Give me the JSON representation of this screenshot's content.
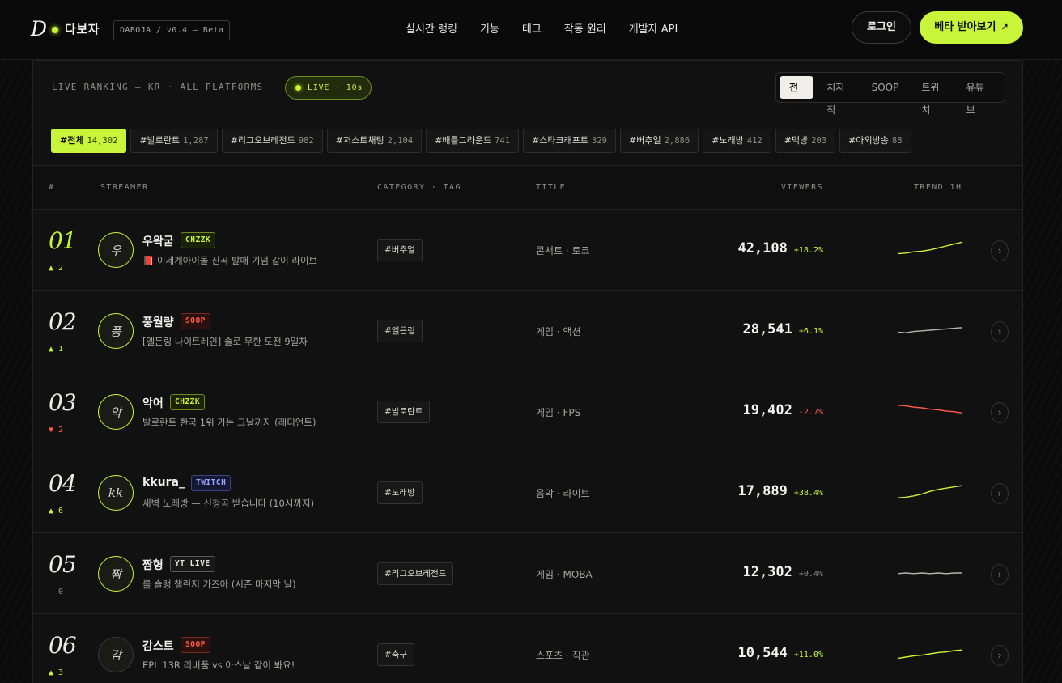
{
  "brand": {
    "logo_letter": "D",
    "name": "다보자",
    "version": "DABOJA / v0.4 — Beta",
    "accent": "#c8f53a"
  },
  "nav": [
    {
      "label": "실시간 랭킹"
    },
    {
      "label": "기능"
    },
    {
      "label": "태그"
    },
    {
      "label": "작동 원리"
    },
    {
      "label": "개발자 API"
    }
  ],
  "auth": {
    "login_label": "로그인",
    "beta_label": "베타 받아보기",
    "beta_arrow": "↗"
  },
  "panel": {
    "title": "LIVE RANKING — KR · ALL PLATFORMS",
    "live_badge": "LIVE · 10s",
    "platform_filters": [
      {
        "label": "전체",
        "active": true
      },
      {
        "label": "치지직",
        "active": false
      },
      {
        "label": "SOOP",
        "active": false
      },
      {
        "label": "트위치",
        "active": false
      },
      {
        "label": "유튜브",
        "active": false
      }
    ]
  },
  "tags": [
    {
      "label": "#전체",
      "count": "14,302",
      "active": true
    },
    {
      "label": "#발로란트",
      "count": "1,287",
      "active": false
    },
    {
      "label": "#리그오브레전드",
      "count": "982",
      "active": false
    },
    {
      "label": "#저스트채팅",
      "count": "2,104",
      "active": false
    },
    {
      "label": "#배틀그라운드",
      "count": "741",
      "active": false
    },
    {
      "label": "#스타크래프트",
      "count": "329",
      "active": false
    },
    {
      "label": "#버추얼",
      "count": "2,886",
      "active": false
    },
    {
      "label": "#노래방",
      "count": "412",
      "active": false
    },
    {
      "label": "#먹방",
      "count": "203",
      "active": false
    },
    {
      "label": "#아외방송",
      "count": "88",
      "active": false
    }
  ],
  "columns": {
    "rank": "#",
    "streamer": "STREAMER",
    "category": "CATEGORY · TAG",
    "title": "TITLE",
    "viewers": "VIEWERS",
    "trend": "TREND 1H"
  },
  "rows": [
    {
      "rank": "01",
      "delta": "▲ 2",
      "delta_dir": "up",
      "avatar": "우",
      "name": "우왁굳",
      "platform": "CHZZK",
      "platform_key": "chzzk",
      "stream_title": "📕 이세계아이돌 신곡 발매 기념 같이 라이브",
      "tag": "#버추얼",
      "genre": "콘서트 · 토크",
      "viewers": "42,108",
      "change": "+18.2%",
      "change_dir": "up",
      "trend": [
        8,
        9,
        11,
        12,
        14,
        17,
        20,
        23,
        26
      ],
      "go": "›"
    },
    {
      "rank": "02",
      "delta": "▲ 1",
      "delta_dir": "up",
      "avatar": "풍",
      "name": "풍월량",
      "platform": "SOOP",
      "platform_key": "soop",
      "stream_title": "[엘든링 나이트레인] 솔로 무한 도전 9일차",
      "tag": "#엘든링",
      "genre": "게임 · 액션",
      "viewers": "28,541",
      "change": "+6.1%",
      "change_dir": "up",
      "trend": [
        12,
        11,
        13,
        14,
        15,
        16,
        17,
        18,
        19
      ],
      "go": "›"
    },
    {
      "rank": "03",
      "delta": "▼ 2",
      "delta_dir": "down",
      "avatar": "악",
      "name": "악어",
      "platform": "CHZZK",
      "platform_key": "chzzk",
      "stream_title": "발로란트 한국 1위 가는 그날까지 (래디언트)",
      "tag": "#발로란트",
      "genre": "게임 · FPS",
      "viewers": "19,402",
      "change": "-2.7%",
      "change_dir": "down",
      "trend": [
        24,
        23,
        21,
        20,
        18,
        17,
        15,
        14,
        12
      ],
      "go": "›"
    },
    {
      "rank": "04",
      "delta": "▲ 6",
      "delta_dir": "up",
      "avatar": "kk",
      "name": "kkura_",
      "platform": "TWITCH",
      "platform_key": "twitch",
      "stream_title": "새벽 노래방 — 신청곡 받습니다 (10시까지)",
      "tag": "#노래방",
      "genre": "음악 · 라이브",
      "viewers": "17,889",
      "change": "+38.4%",
      "change_dir": "up",
      "trend": [
        6,
        7,
        9,
        12,
        16,
        19,
        21,
        23,
        25
      ],
      "go": "›"
    },
    {
      "rank": "05",
      "delta": "– 0",
      "delta_dir": "flat",
      "avatar": "짬",
      "name": "짬형",
      "platform": "YT LIVE",
      "platform_key": "yt",
      "stream_title": "롤 솔랭 챌린저 가즈아 (시즌 마지막 날)",
      "tag": "#리그오브레전드",
      "genre": "게임 · MOBA",
      "viewers": "12,302",
      "change": "+0.4%",
      "change_dir": "flat",
      "trend": [
        14,
        15,
        14,
        15,
        14,
        15,
        14,
        15,
        15
      ],
      "go": "›"
    },
    {
      "rank": "06",
      "delta": "▲ 3",
      "delta_dir": "up",
      "avatar": "감",
      "name": "감스트",
      "platform": "SOOP",
      "platform_key": "soop",
      "stream_title": "EPL 13R 리버풀 vs 아스날 같이 봐요!",
      "tag": "#축구",
      "genre": "스포츠 · 직관",
      "viewers": "10,544",
      "change": "+11.0%",
      "change_dir": "up",
      "trend": [
        8,
        10,
        12,
        13,
        15,
        17,
        18,
        20,
        21
      ],
      "go": "›"
    }
  ],
  "colors": {
    "up": "#c8f53a",
    "down": "#ff5a4a",
    "flat": "#b4b4b0",
    "neutral_line": "#b4b4b0"
  }
}
